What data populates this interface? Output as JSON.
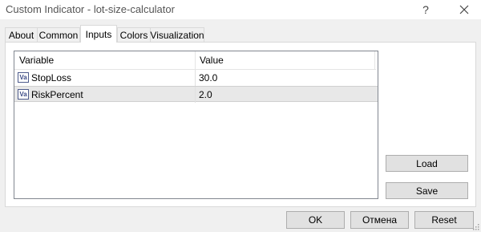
{
  "window": {
    "title": "Custom Indicator - lot-size-calculator",
    "help_label": "?"
  },
  "tabs": [
    {
      "label": "About"
    },
    {
      "label": "Common"
    },
    {
      "label": "Inputs"
    },
    {
      "label": "Colors"
    },
    {
      "label": "Visualization"
    }
  ],
  "active_tab": "Inputs",
  "inputs_table": {
    "headers": {
      "variable": "Variable",
      "value": "Value"
    },
    "rows": [
      {
        "type_icon": "Va",
        "variable": "StopLoss",
        "value": "30.0"
      },
      {
        "type_icon": "Va",
        "variable": "RiskPercent",
        "value": "2.0"
      }
    ],
    "selected_row": "RiskPercent"
  },
  "side_buttons": {
    "load": "Load",
    "save": "Save"
  },
  "footer_buttons": {
    "ok": "OK",
    "cancel": "Отмена",
    "reset": "Reset"
  }
}
